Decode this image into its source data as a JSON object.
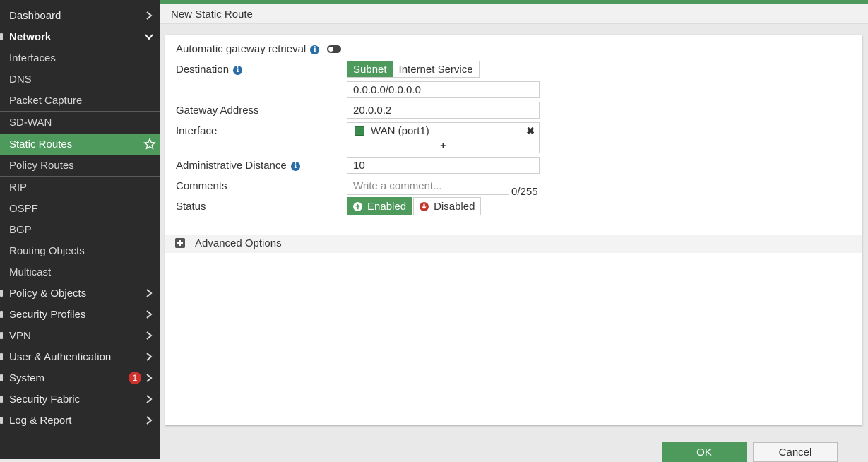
{
  "sidebar": {
    "items": [
      {
        "label": "Dashboard"
      },
      {
        "label": "Network"
      },
      {
        "label": "Interfaces"
      },
      {
        "label": "DNS"
      },
      {
        "label": "Packet Capture"
      },
      {
        "label": "SD-WAN"
      },
      {
        "label": "Static Routes"
      },
      {
        "label": "Policy Routes"
      },
      {
        "label": "RIP"
      },
      {
        "label": "OSPF"
      },
      {
        "label": "BGP"
      },
      {
        "label": "Routing Objects"
      },
      {
        "label": "Multicast"
      },
      {
        "label": "Policy & Objects"
      },
      {
        "label": "Security Profiles"
      },
      {
        "label": "VPN"
      },
      {
        "label": "User & Authentication"
      },
      {
        "label": "System",
        "badge": "1"
      },
      {
        "label": "Security Fabric"
      },
      {
        "label": "Log & Report"
      }
    ]
  },
  "page": {
    "title": "New Static Route"
  },
  "form": {
    "auto_gateway_label": "Automatic gateway retrieval",
    "destination_label": "Destination",
    "dest_options": [
      "Subnet",
      "Internet Service"
    ],
    "destination_value": "0.0.0.0/0.0.0.0",
    "gateway_label": "Gateway Address",
    "gateway_value": "20.0.0.2",
    "interface_label": "Interface",
    "interface_value": "WAN (port1)",
    "admin_distance_label": "Administrative Distance",
    "admin_distance_value": "10",
    "comments_label": "Comments",
    "comments_placeholder": "Write a comment...",
    "comments_counter": "0/255",
    "status_label": "Status",
    "status_enabled": "Enabled",
    "status_disabled": "Disabled",
    "advanced_label": "Advanced Options"
  },
  "buttons": {
    "ok": "OK",
    "cancel": "Cancel"
  },
  "colors": {
    "accent": "#4e9a5d",
    "sidebar_bg": "#2b2b2b",
    "badge": "#d0312d",
    "info": "#2a6ea8"
  },
  "icons": {
    "info": "info-icon",
    "toggle": "toggle-switch-icon",
    "chevron": "chevron-right-icon",
    "star": "star-icon",
    "interface": "port-icon",
    "remove": "close-icon",
    "add": "plus-icon",
    "enabled": "arrow-up-circle-icon",
    "disabled": "arrow-down-circle-icon",
    "expand": "plus-square-icon"
  }
}
